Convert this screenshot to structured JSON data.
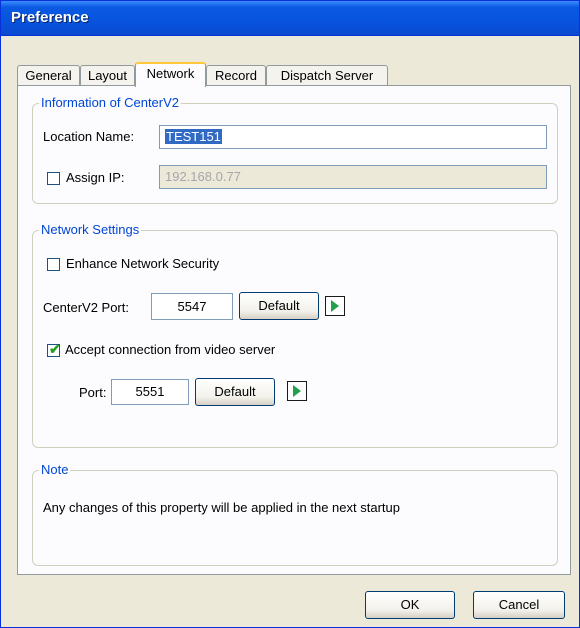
{
  "window": {
    "title": "Preference"
  },
  "tabs": [
    {
      "label": "General"
    },
    {
      "label": "Layout"
    },
    {
      "label": "Network"
    },
    {
      "label": "Record"
    },
    {
      "label": "Dispatch Server"
    }
  ],
  "info_group": {
    "legend": "Information of CenterV2",
    "location_label": "Location Name:",
    "location_value": "TEST151",
    "assign_ip_label": "Assign IP:",
    "assign_ip_checked": false,
    "ip_value": "192.168.0.77"
  },
  "network_group": {
    "legend": "Network Settings",
    "enhance_label": "Enhance Network Security",
    "enhance_checked": false,
    "port_label": "CenterV2 Port:",
    "port_value": "5547",
    "default_label": "Default",
    "accept_label": "Accept connection from video server",
    "accept_checked": true,
    "vs_port_label": "Port:",
    "vs_port_value": "5551",
    "vs_default_label": "Default"
  },
  "note_group": {
    "legend": "Note",
    "text": "Any changes of this property will be applied in the next startup"
  },
  "footer": {
    "ok_label": "OK",
    "cancel_label": "Cancel"
  },
  "colors": {
    "title_bar": "#0a5ae4",
    "legend_text": "#0046d5",
    "selection": "#316ac5",
    "check_tick": "#21a121",
    "play_arrow": "#21a14a"
  },
  "icons": {
    "checkbox_tick": "✔"
  }
}
